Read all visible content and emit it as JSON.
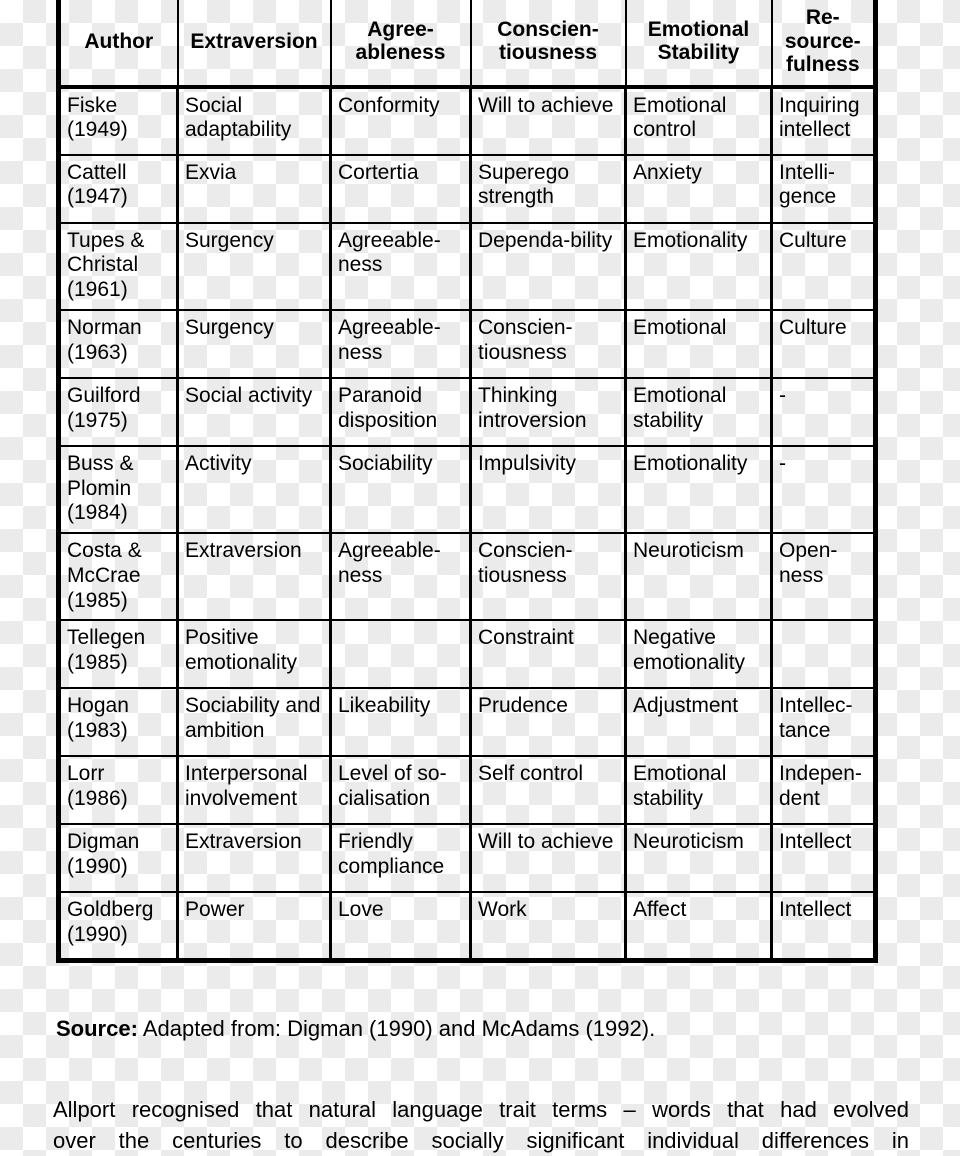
{
  "table": {
    "columns": [
      {
        "key": "author",
        "label": "Author"
      },
      {
        "key": "extraversion",
        "label": "Extraversion"
      },
      {
        "key": "agreeableness",
        "label": "Agree-\nableness"
      },
      {
        "key": "conscientiousness",
        "label": "Conscien-\ntiousness"
      },
      {
        "key": "emotional_stability",
        "label": "Emotional\nStability"
      },
      {
        "key": "resourcefulness",
        "label": "Re-\nsource-\nfulness"
      }
    ],
    "header_labels": {
      "author": "Author",
      "extraversion": "Extraversion",
      "agreeableness_l1": "Agree-",
      "agreeableness_l2": "ableness",
      "conscientiousness_l1": "Conscien-",
      "conscientiousness_l2": "tiousness",
      "emotional_l1": "Emotional",
      "emotional_l2": "Stability",
      "resourcefulness_l1": "Re-",
      "resourcefulness_l2": "source-",
      "resourcefulness_l3": "fulness"
    },
    "rows": [
      {
        "author": "Fiske\n(1949)",
        "extraversion": "Social adaptability",
        "agreeableness": "Conformity",
        "conscientiousness": "Will to achieve",
        "emotional_stability": "Emotional control",
        "resourcefulness": "Inquiring intellect"
      },
      {
        "author": "Cattell\n(1947)",
        "extraversion": "Exvia",
        "agreeableness": "Cortertia",
        "conscientiousness": "Superego strength",
        "emotional_stability": "Anxiety",
        "resourcefulness": "Intelli-gence"
      },
      {
        "author": "Tupes & Christal\n(1961)",
        "extraversion": "Surgency",
        "agreeableness": "Agreeable-ness",
        "conscientiousness": "Dependa-bility",
        "emotional_stability": "Emotionality",
        "resourcefulness": "Culture"
      },
      {
        "author": "Norman\n(1963)",
        "extraversion": "Surgency",
        "agreeableness": "Agreeable-ness",
        "conscientiousness": "Conscien-tiousness",
        "emotional_stability": "Emotional",
        "resourcefulness": "Culture"
      },
      {
        "author": "Guilford\n(1975)",
        "extraversion": "Social activity",
        "agreeableness": "Paranoid disposition",
        "conscientiousness": "Thinking introversion",
        "emotional_stability": "Emotional stability",
        "resourcefulness": "-"
      },
      {
        "author": "Buss & Plomin\n(1984)",
        "extraversion": "Activity",
        "agreeableness": "Sociability",
        "conscientiousness": "Impulsivity",
        "emotional_stability": "Emotionality",
        "resourcefulness": "-"
      },
      {
        "author": "Costa & McCrae\n(1985)",
        "extraversion": "Extraversion",
        "agreeableness": "Agreeable-ness",
        "conscientiousness": "Conscien-tiousness",
        "emotional_stability": "Neuroticism",
        "resourcefulness": "Open-ness"
      },
      {
        "author": "Tellegen\n(1985)",
        "extraversion": "Positive emotionality",
        "agreeableness": "",
        "conscientiousness": "Constraint",
        "emotional_stability": "Negative emotionality",
        "resourcefulness": ""
      },
      {
        "author": "Hogan\n(1983)",
        "extraversion": "Sociability and ambition",
        "agreeableness": "Likeability",
        "conscientiousness": "Prudence",
        "emotional_stability": "Adjustment",
        "resourcefulness": "Intellec-tance"
      },
      {
        "author": "Lorr\n(1986)",
        "extraversion": "Interpersonal involvement",
        "agreeableness": "Level of so-cialisation",
        "conscientiousness": "Self control",
        "emotional_stability": "Emotional stability",
        "resourcefulness": "Indepen-dent"
      },
      {
        "author": "Digman\n(1990)",
        "extraversion": "Extraversion",
        "agreeableness": "Friendly compliance",
        "conscientiousness": "Will to achieve",
        "emotional_stability": "Neuroticism",
        "resourcefulness": "Intellect"
      },
      {
        "author": "Goldberg\n(1990)",
        "extraversion": "Power",
        "agreeableness": "Love",
        "conscientiousness": "Work",
        "emotional_stability": "Affect",
        "resourcefulness": "Intellect"
      }
    ]
  },
  "source": {
    "label": "Source:",
    "text": "Adapted from: Digman (1990) and McAdams (1992)."
  },
  "paragraph": {
    "line1_words": [
      "Allport",
      "recognised",
      "that",
      "natural",
      "language",
      "trait",
      "terms",
      "–",
      "words",
      "that",
      "had",
      "evolved"
    ],
    "line2_words": [
      "over",
      "the",
      "centuries",
      "to",
      "describe",
      "socially",
      "significant",
      "individual",
      "differences",
      "in"
    ]
  }
}
